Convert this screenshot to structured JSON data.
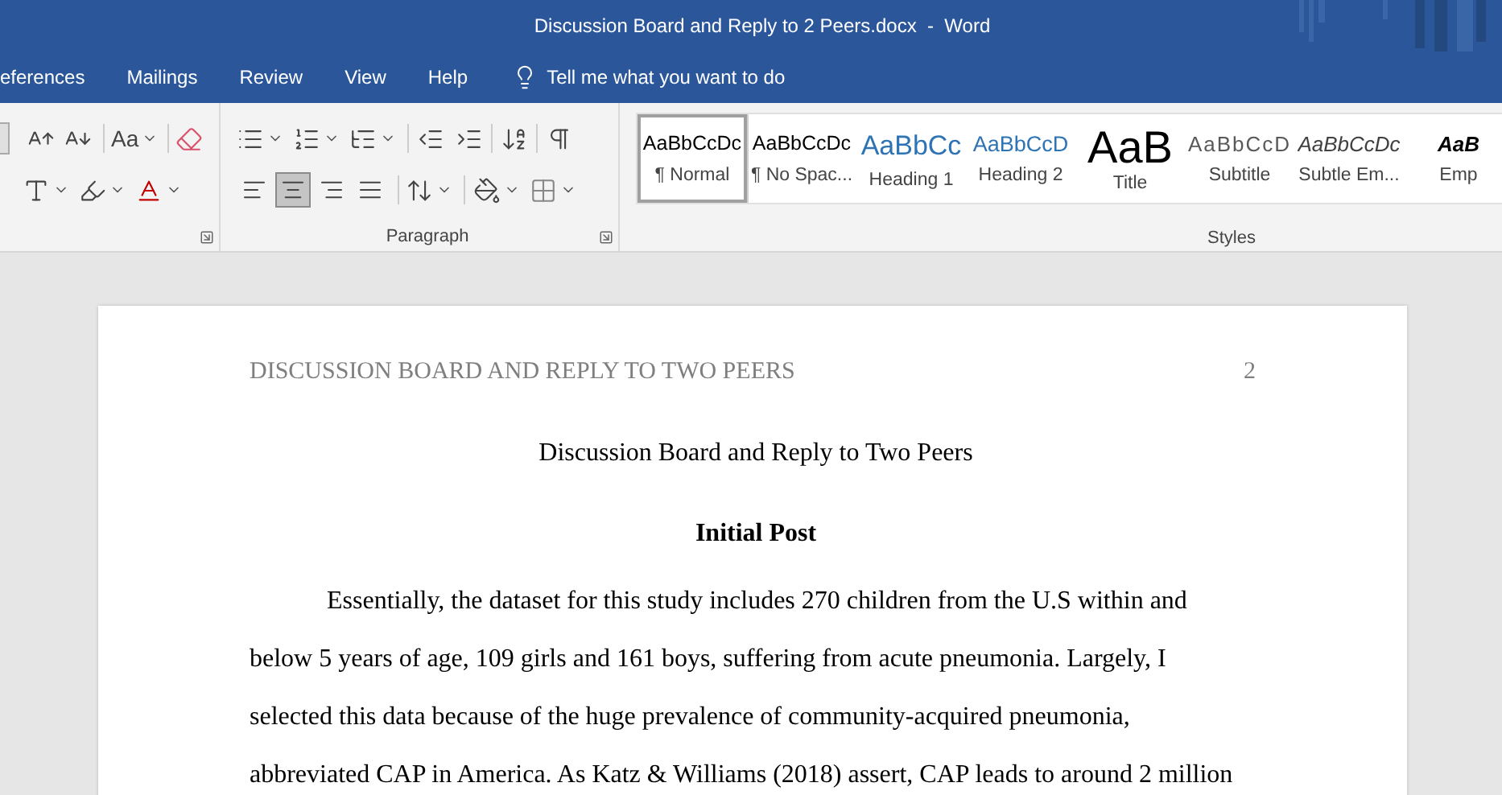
{
  "window": {
    "title": "Discussion Board and Reply to 2 Peers.docx  -  Word"
  },
  "tabs": [
    {
      "label": "eferences",
      "selected": false
    },
    {
      "label": "Mailings",
      "selected": false
    },
    {
      "label": "Review",
      "selected": false
    },
    {
      "label": "View",
      "selected": false
    },
    {
      "label": "Help",
      "selected": false
    }
  ],
  "tell_me": {
    "placeholder": "Tell me what you want to do"
  },
  "font_group": {
    "change_case": "Aa"
  },
  "paragraph_group": {
    "label": "Paragraph",
    "alignments": [
      {
        "kind": "left",
        "selected": false
      },
      {
        "kind": "center",
        "selected": true
      },
      {
        "kind": "right",
        "selected": false
      },
      {
        "kind": "justify",
        "selected": false
      }
    ]
  },
  "styles_group": {
    "label": "Styles",
    "styles": [
      {
        "kind": "normal",
        "preview": "AaBbCcDc",
        "label": "¶ Normal",
        "selected": true
      },
      {
        "kind": "normal",
        "preview": "AaBbCcDc",
        "label": "¶ No Spac...",
        "selected": false
      },
      {
        "kind": "heading1",
        "preview": "AaBbCc",
        "label": "Heading 1",
        "selected": false
      },
      {
        "kind": "heading2",
        "preview": "AaBbCcD",
        "label": "Heading 2",
        "selected": false
      },
      {
        "kind": "title",
        "preview": "AaB",
        "label": "Title",
        "selected": false
      },
      {
        "kind": "subtitle",
        "preview": "AaBbCcD",
        "label": "Subtitle",
        "selected": false
      },
      {
        "kind": "emphasis",
        "preview": "AaBbCcDc",
        "label": "Subtle Em...",
        "selected": false
      },
      {
        "kind": "emphasis_bold",
        "preview": "AaB",
        "label": "Emp",
        "selected": false
      }
    ]
  },
  "document": {
    "header": "DISCUSSION BOARD AND REPLY TO TWO PEERS",
    "page_number": "2",
    "title": "Discussion Board and Reply to Two Peers",
    "heading": "Initial Post",
    "paragraph": "Essentially, the dataset for this study includes 270 children from the U.S within and\nbelow 5 years of age, 109 girls and 161 boys, suffering from acute pneumonia. Largely, I\nselected this data because of the huge prevalence of community-acquired pneumonia,\nabbreviated CAP in America. As Katz & Williams (2018) assert, CAP leads to around 2 million"
  }
}
